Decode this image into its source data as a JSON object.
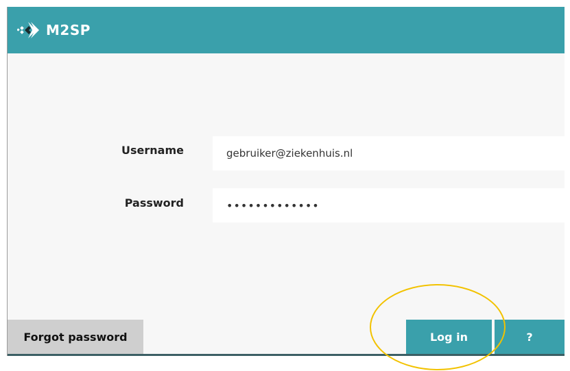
{
  "header": {
    "app_name": "M2SP",
    "logo_icon": "m2sp-diamond-logo-icon",
    "background_color": "#3aa0ab"
  },
  "login_form": {
    "username_label": "Username",
    "username_value": "gebruiker@ziekenhuis.nl",
    "password_label": "Password",
    "password_value": "•••••••••••••"
  },
  "footer": {
    "forgot_password_label": "Forgot password",
    "login_label": "Log in",
    "help_label": "?"
  },
  "colors": {
    "accent": "#3aa0ab",
    "secondary_button": "#cfcfcf",
    "highlight": "#f2c200"
  }
}
